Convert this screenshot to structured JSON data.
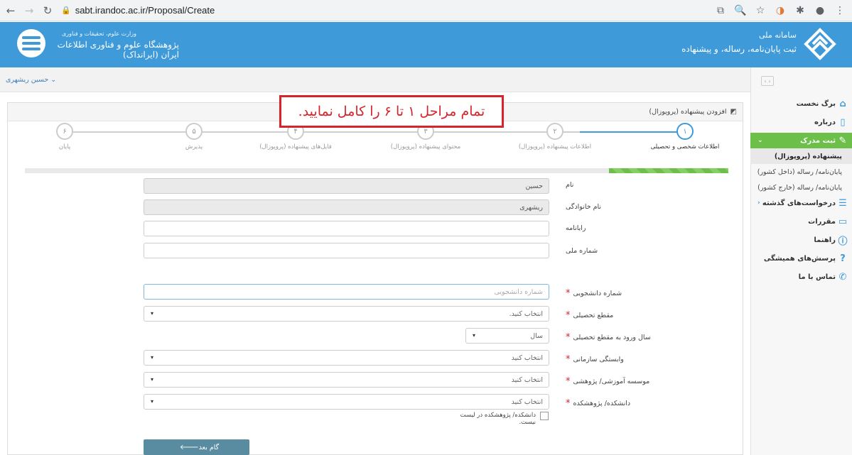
{
  "browser": {
    "url": "sabt.irandoc.ac.ir/Proposal/Create",
    "back_icon": "arrow-left-icon",
    "forward_icon": "arrow-right-icon",
    "reload_icon": "reload-icon"
  },
  "header": {
    "left_small": "وزارت علوم، تحقیقات و فناوری",
    "left_title": "پژوهشگاه علوم و فناوری اطلاعات ایران (ایرانداک)",
    "right_small": "سامانه ملی",
    "right_title": "ثبت پایان‌نامه، رساله، و پیشنهاده"
  },
  "user": {
    "name": "حسین ریشهری ⌄"
  },
  "sidebar": {
    "toggle": "‹ ›",
    "items": [
      {
        "label": "برگ نخست",
        "icon": "home-icon"
      },
      {
        "label": "درباره",
        "icon": "file-icon"
      },
      {
        "label": "ثبت مدرک",
        "icon": "edit-icon",
        "arrow": "⌄"
      },
      {
        "label": "درخواست‌های گذشته",
        "icon": "list-icon",
        "arrow": "‹"
      },
      {
        "label": "مقررات",
        "icon": "folder-icon"
      },
      {
        "label": "راهنما",
        "icon": "info-icon"
      },
      {
        "label": "پرسش‌های همیشگی",
        "icon": "question-icon"
      },
      {
        "label": "تماس با ما",
        "icon": "phone-icon"
      }
    ],
    "subitems": [
      "پیشنهاده (پروپوزال)",
      "پایان‌نامه/ رساله (داخل کشور)",
      "پایان‌نامه/ رساله (خارج کشور)"
    ]
  },
  "panel": {
    "title": "افزودن پیشنهاده (پروپوزال)"
  },
  "notice": "تمام مراحل ۱ تا ۶ را کامل نمایید.",
  "steps": [
    {
      "num": "۱",
      "label": "اطلاعات شخصی و تحصیلی"
    },
    {
      "num": "۲",
      "label": "اطلاعات پیشنهاده (پروپوزال)"
    },
    {
      "num": "۳",
      "label": "محتوای پیشنهاده (پروپوزال)"
    },
    {
      "num": "۴",
      "label": "فایل‌های پیشنهاده (پروپوزال)"
    },
    {
      "num": "۵",
      "label": "پذیرش"
    },
    {
      "num": "۶",
      "label": "پایان"
    }
  ],
  "progress_fraction": 0.17,
  "form": {
    "first_name": {
      "label": "نام",
      "value": "حسین"
    },
    "last_name": {
      "label": "نام خانوادگی",
      "value": "ریشهری"
    },
    "email": {
      "label": "رایانامه",
      "value": ""
    },
    "national_id": {
      "label": "شماره ملی",
      "value": ""
    },
    "student_id": {
      "label": "شماره دانشجویی",
      "placeholder": "شماره دانشجویی"
    },
    "degree": {
      "label": "مقطع تحصیلی",
      "value": "انتخاب کنید."
    },
    "entry_year": {
      "label": "سال ورود به مقطع تحصیلی",
      "value": "سال"
    },
    "affiliation": {
      "label": "وابستگی سازمانی",
      "value": "انتخاب کنید"
    },
    "institute": {
      "label": "موسسه آموزشی/ پژوهشی",
      "value": "انتخاب کنید"
    },
    "faculty": {
      "label": "دانشکده/ پژوهشکده",
      "value": "انتخاب کنید"
    },
    "faculty_not_listed": "دانشکده/ پژوهشکده در لیست نیست.",
    "required_mark": "*"
  },
  "next_button": "گام بعد"
}
